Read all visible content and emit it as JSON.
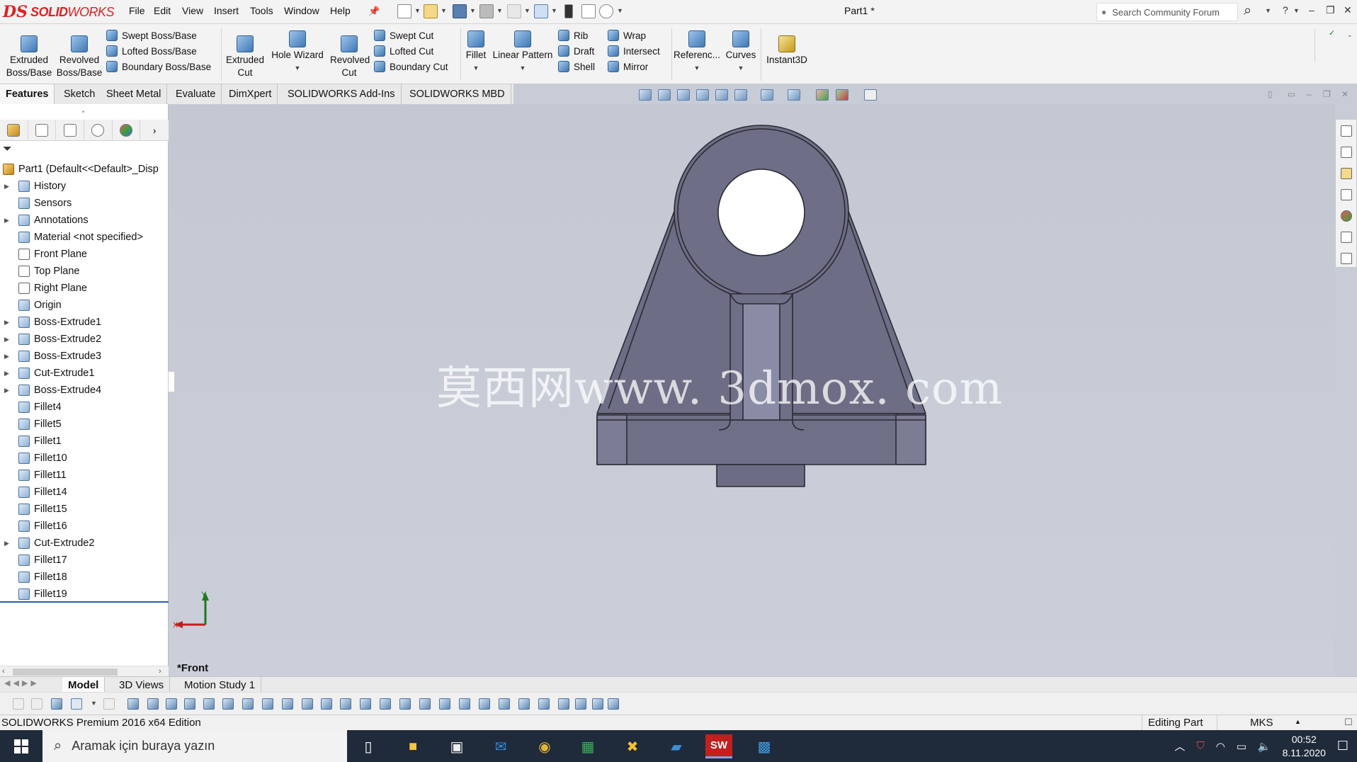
{
  "app": {
    "logo_prefix": "DS",
    "logo_text": "SOLID",
    "logo_text2": "WORKS",
    "document_title": "Part1 *",
    "search_placeholder": "Search Community Forum"
  },
  "menu": [
    "File",
    "Edit",
    "View",
    "Insert",
    "Tools",
    "Window",
    "Help"
  ],
  "commands": {
    "extruded_boss": "Extruded Boss/Base",
    "revolved_boss": "Revolved Boss/Base",
    "swept_boss": "Swept Boss/Base",
    "lofted_boss": "Lofted Boss/Base",
    "boundary_boss": "Boundary Boss/Base",
    "extruded_cut": "Extruded Cut",
    "hole_wizard": "Hole Wizard",
    "revolved_cut": "Revolved Cut",
    "swept_cut": "Swept Cut",
    "lofted_cut": "Lofted Cut",
    "boundary_cut": "Boundary Cut",
    "fillet": "Fillet",
    "linear_pattern": "Linear Pattern",
    "rib": "Rib",
    "draft": "Draft",
    "shell": "Shell",
    "wrap": "Wrap",
    "intersect": "Intersect",
    "mirror": "Mirror",
    "reference": "Referenc...",
    "curves": "Curves",
    "instant3d": "Instant3D"
  },
  "tabs": [
    "Features",
    "Sketch",
    "Sheet Metal",
    "Evaluate",
    "DimXpert",
    "SOLIDWORKS Add-Ins",
    "SOLIDWORKS MBD"
  ],
  "tree": {
    "root": "Part1  (Default<<Default>_Disp",
    "items": [
      {
        "label": "History",
        "expand": true,
        "kind": "folder"
      },
      {
        "label": "Sensors",
        "expand": false,
        "kind": "folder"
      },
      {
        "label": "Annotations",
        "expand": true,
        "kind": "folder"
      },
      {
        "label": "Material <not specified>",
        "expand": false,
        "kind": "material"
      },
      {
        "label": "Front Plane",
        "expand": false,
        "kind": "plane"
      },
      {
        "label": "Top Plane",
        "expand": false,
        "kind": "plane"
      },
      {
        "label": "Right Plane",
        "expand": false,
        "kind": "plane"
      },
      {
        "label": "Origin",
        "expand": false,
        "kind": "origin"
      },
      {
        "label": "Boss-Extrude1",
        "expand": true,
        "kind": "feature"
      },
      {
        "label": "Boss-Extrude2",
        "expand": true,
        "kind": "feature"
      },
      {
        "label": "Boss-Extrude3",
        "expand": true,
        "kind": "feature"
      },
      {
        "label": "Cut-Extrude1",
        "expand": true,
        "kind": "feature"
      },
      {
        "label": "Boss-Extrude4",
        "expand": true,
        "kind": "feature"
      },
      {
        "label": "Fillet4",
        "expand": false,
        "kind": "feature"
      },
      {
        "label": "Fillet5",
        "expand": false,
        "kind": "feature"
      },
      {
        "label": "Fillet1",
        "expand": false,
        "kind": "feature"
      },
      {
        "label": "Fillet10",
        "expand": false,
        "kind": "feature"
      },
      {
        "label": "Fillet11",
        "expand": false,
        "kind": "feature"
      },
      {
        "label": "Fillet14",
        "expand": false,
        "kind": "feature"
      },
      {
        "label": "Fillet15",
        "expand": false,
        "kind": "feature"
      },
      {
        "label": "Fillet16",
        "expand": false,
        "kind": "feature"
      },
      {
        "label": "Cut-Extrude2",
        "expand": true,
        "kind": "feature"
      },
      {
        "label": "Fillet17",
        "expand": false,
        "kind": "feature"
      },
      {
        "label": "Fillet18",
        "expand": false,
        "kind": "feature"
      },
      {
        "label": "Fillet19",
        "expand": false,
        "kind": "feature"
      }
    ]
  },
  "viewport": {
    "view_name": "*Front",
    "watermark": "莫西网www. 3dmox. com",
    "axis_x": "X",
    "axis_y": "Y"
  },
  "bottom_tabs": [
    "Model",
    "3D Views",
    "Motion Study 1"
  ],
  "status": {
    "edition": "SOLIDWORKS Premium 2016 x64 Edition",
    "editing": "Editing Part",
    "units": "MKS"
  },
  "taskbar": {
    "search_placeholder": "Aramak için buraya yazın",
    "time": "00:52",
    "date": "8.11.2020",
    "sw_badge": "SW"
  },
  "colors": {
    "part_face": "#6d6e85",
    "part_edge": "#2a2a33",
    "logo_red": "#d22222",
    "taskbar": "#1f2a3a"
  }
}
